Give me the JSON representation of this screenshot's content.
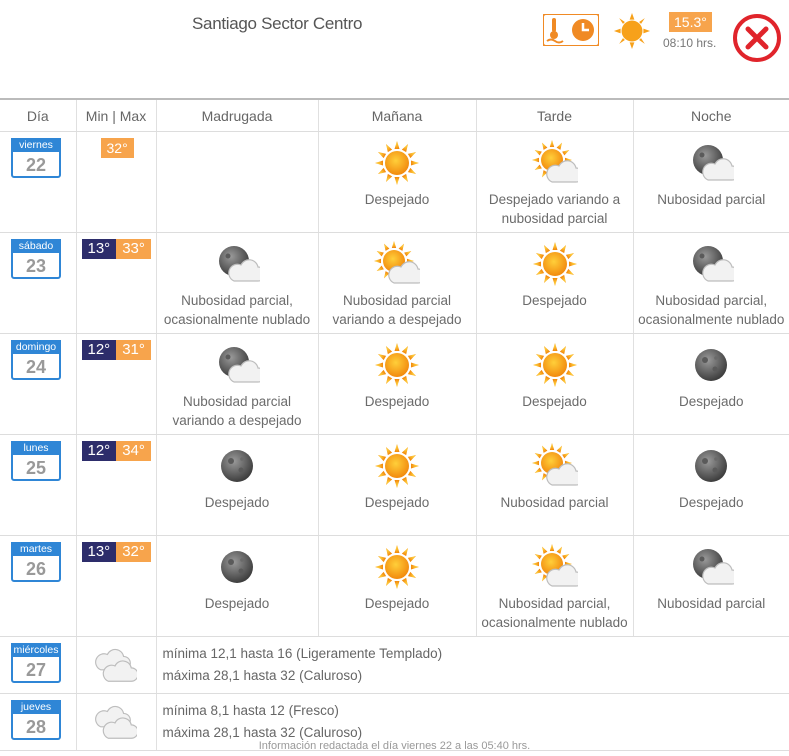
{
  "header": {
    "location": "Santiago Sector Centro",
    "current_temp": "15.3°",
    "current_time": "08:10 hrs.",
    "current_icon": "sun-icon",
    "close_icon": "close-icon"
  },
  "columns": [
    "Día",
    "Min | Max",
    "Madrugada",
    "Mañana",
    "Tarde",
    "Noche"
  ],
  "days": [
    {
      "weekday": "viernes",
      "day": "22",
      "min": "",
      "max": "32°",
      "periods": [
        {
          "icon": "none",
          "text": ""
        },
        {
          "icon": "sun",
          "text": "Despejado"
        },
        {
          "icon": "sun-cloud",
          "text": "Despejado variando a nubosidad parcial"
        },
        {
          "icon": "moon-cloud",
          "text": "Nubosidad parcial"
        }
      ]
    },
    {
      "weekday": "sábado",
      "day": "23",
      "min": "13°",
      "max": "33°",
      "periods": [
        {
          "icon": "moon-cloud",
          "text": "Nubosidad parcial, ocasionalmente nublado"
        },
        {
          "icon": "sun-cloud",
          "text": "Nubosidad parcial variando a despejado"
        },
        {
          "icon": "sun",
          "text": "Despejado"
        },
        {
          "icon": "moon-cloud",
          "text": "Nubosidad parcial, ocasionalmente nublado"
        }
      ]
    },
    {
      "weekday": "domingo",
      "day": "24",
      "min": "12°",
      "max": "31°",
      "periods": [
        {
          "icon": "moon-cloud",
          "text": "Nubosidad parcial variando a despejado"
        },
        {
          "icon": "sun",
          "text": "Despejado"
        },
        {
          "icon": "sun",
          "text": "Despejado"
        },
        {
          "icon": "moon",
          "text": "Despejado"
        }
      ]
    },
    {
      "weekday": "lunes",
      "day": "25",
      "min": "12°",
      "max": "34°",
      "periods": [
        {
          "icon": "moon",
          "text": "Despejado"
        },
        {
          "icon": "sun",
          "text": "Despejado"
        },
        {
          "icon": "sun-cloud",
          "text": "Nubosidad parcial"
        },
        {
          "icon": "moon",
          "text": "Despejado"
        }
      ]
    },
    {
      "weekday": "martes",
      "day": "26",
      "min": "13°",
      "max": "32°",
      "periods": [
        {
          "icon": "moon",
          "text": "Despejado"
        },
        {
          "icon": "sun",
          "text": "Despejado"
        },
        {
          "icon": "sun-cloud",
          "text": "Nubosidad parcial, ocasionalmente nublado"
        },
        {
          "icon": "moon-cloud",
          "text": "Nubosidad parcial"
        }
      ]
    }
  ],
  "extended": [
    {
      "weekday": "miércoles",
      "day": "27",
      "icon": "cloudy",
      "min_text": "mínima 12,1 hasta 16 (Ligeramente Templado)",
      "max_text": "máxima 28,1 hasta 32 (Caluroso)"
    },
    {
      "weekday": "jueves",
      "day": "28",
      "icon": "cloudy",
      "min_text": "mínima 8,1 hasta 12 (Fresco)",
      "max_text": "máxima 28,1 hasta 32 (Caluroso)"
    }
  ],
  "footer": "Información redactada el día viernes 22 a las 05:40 hrs.",
  "colors": {
    "accent_blue": "#2f86d6",
    "max_orange": "#f7a44c",
    "min_navy": "#2d2d6b",
    "close_red": "#e0242b"
  }
}
